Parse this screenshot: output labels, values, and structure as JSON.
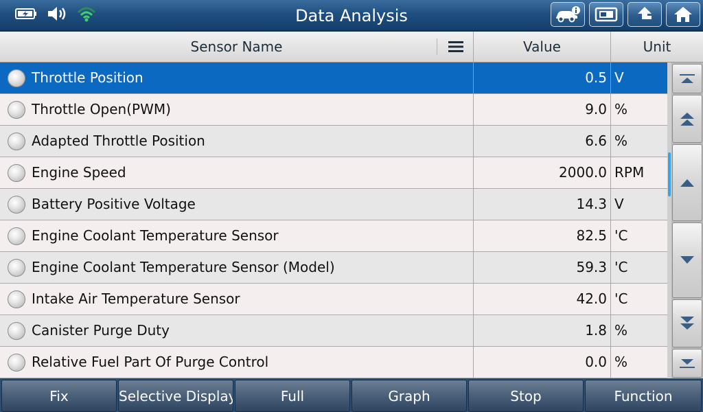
{
  "title": "Data Analysis",
  "status_icons": [
    "battery-icon",
    "speaker-icon",
    "wifi-icon"
  ],
  "nav_buttons": [
    {
      "name": "vehicle-info-button",
      "icon": "car-info-icon"
    },
    {
      "name": "print-button",
      "icon": "printer-icon"
    },
    {
      "name": "back-button",
      "icon": "up-arrow-icon"
    },
    {
      "name": "home-button",
      "icon": "home-icon"
    }
  ],
  "columns": {
    "sensor_name": "Sensor Name",
    "value": "Value",
    "unit": "Unit"
  },
  "rows": [
    {
      "name": "Throttle Position",
      "value": "0.5",
      "unit": "V",
      "selected": true
    },
    {
      "name": "Throttle Open(PWM)",
      "value": "9.0",
      "unit": "%"
    },
    {
      "name": "Adapted Throttle Position",
      "value": "6.6",
      "unit": "%"
    },
    {
      "name": "Engine Speed",
      "value": "2000.0",
      "unit": "RPM"
    },
    {
      "name": "Battery Positive Voltage",
      "value": "14.3",
      "unit": "V"
    },
    {
      "name": "Engine Coolant Temperature Sensor",
      "value": "82.5",
      "unit": "'C"
    },
    {
      "name": "Engine Coolant Temperature Sensor (Model)",
      "value": "59.3",
      "unit": "'C"
    },
    {
      "name": "Intake Air Temperature Sensor",
      "value": "42.0",
      "unit": "'C"
    },
    {
      "name": "Canister Purge Duty",
      "value": "1.8",
      "unit": "%"
    },
    {
      "name": "Relative Fuel Part Of Purge Control",
      "value": "0.0",
      "unit": "%"
    }
  ],
  "footer": {
    "fix": "Fix",
    "selective_display": "Selective Display",
    "full": "Full",
    "graph": "Graph",
    "stop": "Stop",
    "function": "Function"
  },
  "colors": {
    "selected_row": "#0b69c1",
    "titlebar": "#1f4f80",
    "scroll_indicator": "#39a3e6"
  }
}
